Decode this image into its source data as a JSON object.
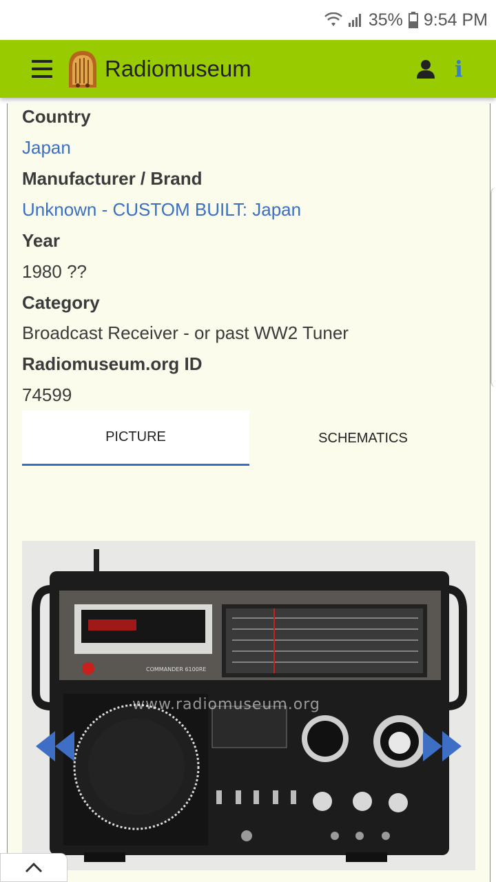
{
  "status_bar": {
    "battery": "35%",
    "time": "9:54 PM"
  },
  "header": {
    "title": "Radiomuseum"
  },
  "details": {
    "country_label": "Country",
    "country_value": "Japan",
    "manufacturer_label": "Manufacturer / Brand",
    "manufacturer_value": "Unknown - CUSTOM BUILT: Japan",
    "year_label": "Year",
    "year_value": "1980 ??",
    "category_label": "Category",
    "category_value": "Broadcast Receiver - or past WW2 Tuner",
    "id_label": "Radiomuseum.org ID",
    "id_value": "74599"
  },
  "tabs": [
    {
      "label": "PICTURE",
      "active": true
    },
    {
      "label": "SCHEMATICS",
      "active": false
    }
  ],
  "photo": {
    "watermark": "www.radiomuseum.org",
    "model_text": "COMMANDER 6100RE"
  },
  "colors": {
    "header_bg": "#99cc00",
    "link": "#3a6fc4",
    "panel_bg": "#fbfcec"
  },
  "icons": [
    "hamburger-menu-icon",
    "radiomuseum-logo",
    "user-icon",
    "info-icon",
    "wifi-icon",
    "signal-icon",
    "battery-icon",
    "chevron-left-icon",
    "chevron-right-icon",
    "chevron-up-icon"
  ]
}
